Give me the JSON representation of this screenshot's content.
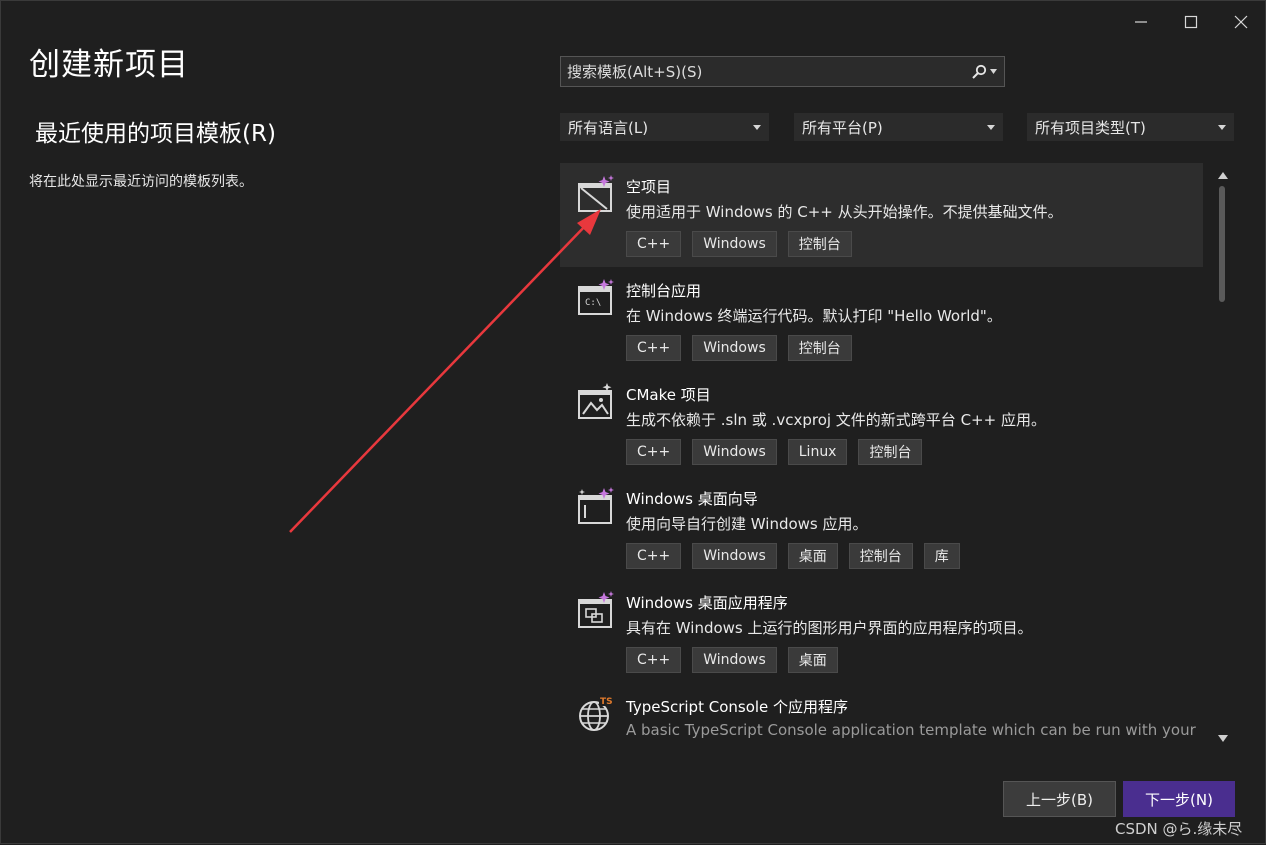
{
  "window": {
    "title": "创建新项目",
    "controls": [
      "minimize-icon",
      "maximize-icon",
      "close-icon"
    ]
  },
  "recent": {
    "heading": "最近使用的项目模板(R)",
    "empty_text": "将在此处显示最近访问的模板列表。"
  },
  "search": {
    "placeholder": "搜索模板(Alt+S)(S)",
    "icon": "search-icon"
  },
  "filters": [
    {
      "label": "所有语言(L)"
    },
    {
      "label": "所有平台(P)"
    },
    {
      "label": "所有项目类型(T)"
    }
  ],
  "templates": [
    {
      "name": "空项目",
      "description": "使用适用于 Windows 的 C++ 从头开始操作。不提供基础文件。",
      "tags": [
        "C++",
        "Windows",
        "控制台"
      ],
      "icon": "empty-project-icon",
      "selected": true
    },
    {
      "name": "控制台应用",
      "description": "在 Windows 终端运行代码。默认打印 \"Hello World\"。",
      "tags": [
        "C++",
        "Windows",
        "控制台"
      ],
      "icon": "console-app-icon",
      "selected": false
    },
    {
      "name": "CMake 项目",
      "description": "生成不依赖于 .sln 或 .vcxproj 文件的新式跨平台 C++ 应用。",
      "tags": [
        "C++",
        "Windows",
        "Linux",
        "控制台"
      ],
      "icon": "cmake-project-icon",
      "selected": false
    },
    {
      "name": "Windows 桌面向导",
      "description": "使用向导自行创建 Windows 应用。",
      "tags": [
        "C++",
        "Windows",
        "桌面",
        "控制台",
        "库"
      ],
      "icon": "desktop-wizard-icon",
      "selected": false
    },
    {
      "name": "Windows 桌面应用程序",
      "description": "具有在 Windows 上运行的图形用户界面的应用程序的项目。",
      "tags": [
        "C++",
        "Windows",
        "桌面"
      ],
      "icon": "desktop-app-icon",
      "selected": false
    },
    {
      "name": "TypeScript Console 个应用程序",
      "description": "A basic TypeScript Console application template which can be run with your",
      "tags": [],
      "icon": "typescript-globe-icon",
      "selected": false
    }
  ],
  "buttons": {
    "back": "上一步(B)",
    "next": "下一步(N)"
  },
  "watermark": "CSDN @ら.缘未尽",
  "colors": {
    "background": "#1f1f1f",
    "accent": "#4a2e8f",
    "annotation_arrow": "#e8383d",
    "icon_sparkle": "#c678dd",
    "typescript_badge": "#e07a2c"
  }
}
